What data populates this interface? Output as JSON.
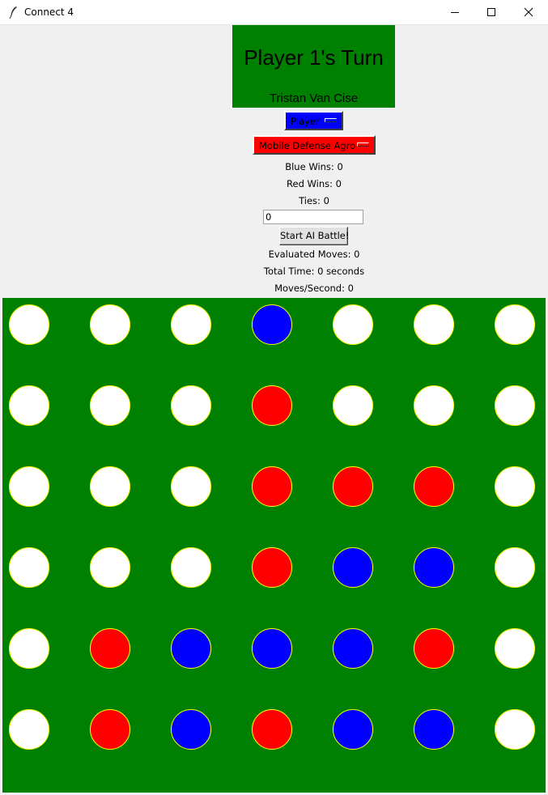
{
  "window": {
    "title": "Connect 4",
    "icon": "feather-icon",
    "controls": [
      "minimize-icon",
      "maximize-icon",
      "close-icon"
    ]
  },
  "header": {
    "turn_text": "Player 1's Turn",
    "author": "Tristan Van Cise",
    "banner_color": "#008000"
  },
  "players": {
    "player1": {
      "selected": "Player",
      "color": "#0000ff"
    },
    "player2": {
      "selected": "Mobile Defense Agro",
      "color": "#ff0000"
    }
  },
  "stats": {
    "blue_wins": "Blue Wins: 0",
    "red_wins": "Red Wins: 0",
    "ties": "Ties: 0"
  },
  "battle": {
    "count_value": "0",
    "start_label": "Start AI Battle!"
  },
  "performance": {
    "evaluated_moves": "Evaluated Moves: 0",
    "total_time": "Total Time: 0 seconds",
    "moves_per_second": "Moves/Second: 0"
  },
  "board": {
    "rows": 6,
    "cols": 7,
    "colors": {
      "W": "#ffffff",
      "R": "#ff0000",
      "B": "#0000ff",
      "outline": "#ffff00",
      "background": "#008000"
    },
    "cells": [
      [
        "W",
        "W",
        "W",
        "B",
        "W",
        "W",
        "W"
      ],
      [
        "W",
        "W",
        "W",
        "R",
        "W",
        "W",
        "W"
      ],
      [
        "W",
        "W",
        "W",
        "R",
        "R",
        "R",
        "W"
      ],
      [
        "W",
        "W",
        "W",
        "R",
        "B",
        "B",
        "W"
      ],
      [
        "W",
        "R",
        "B",
        "B",
        "B",
        "R",
        "W"
      ],
      [
        "W",
        "R",
        "B",
        "R",
        "B",
        "B",
        "W"
      ]
    ]
  }
}
